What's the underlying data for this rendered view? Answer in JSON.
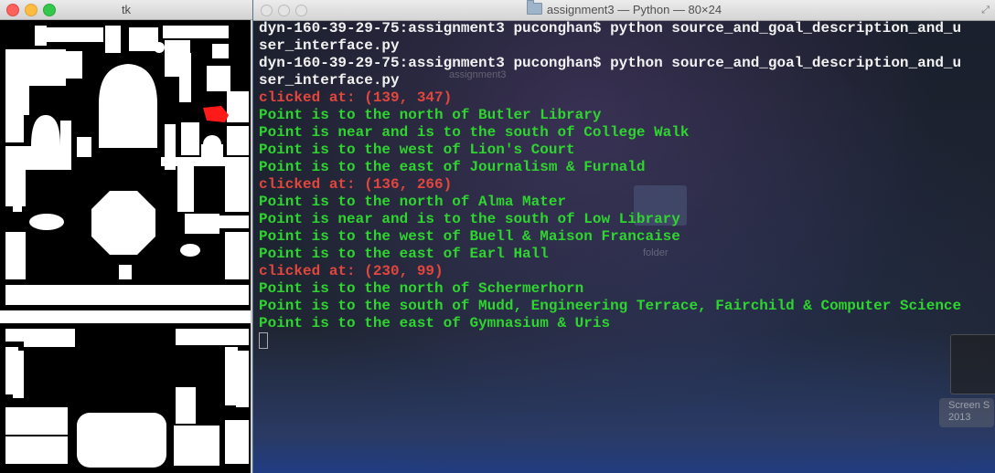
{
  "tk_window": {
    "title": "tk",
    "marker_color": "#ff1a1a"
  },
  "terminal": {
    "title": "assignment3 — Python — 80×24",
    "desktop_labels": [
      "assignment3",
      "folder"
    ],
    "desktop_screenshot_label": "Screen S\n2013",
    "colors": {
      "prompt": "#f2f2f2",
      "clicked": "#e2463c",
      "point": "#2fd52f"
    },
    "lines": [
      {
        "kind": "prompt",
        "text": "dyn-160-39-29-75:assignment3 puconghan$ python source_and_goal_description_and_u"
      },
      {
        "kind": "prompt",
        "text": "ser_interface.py"
      },
      {
        "kind": "prompt",
        "text": "dyn-160-39-29-75:assignment3 puconghan$ python source_and_goal_description_and_u"
      },
      {
        "kind": "prompt",
        "text": "ser_interface.py"
      },
      {
        "kind": "click",
        "text": "clicked at: (139, 347)"
      },
      {
        "kind": "point",
        "text": "Point is to the north of Butler Library"
      },
      {
        "kind": "point",
        "text": "Point is near and is to the south of College Walk"
      },
      {
        "kind": "point",
        "text": "Point is to the west of Lion's Court"
      },
      {
        "kind": "point",
        "text": "Point is to the east of Journalism & Furnald"
      },
      {
        "kind": "click",
        "text": "clicked at: (136, 266)"
      },
      {
        "kind": "point",
        "text": "Point is to the north of Alma Mater"
      },
      {
        "kind": "point",
        "text": "Point is near and is to the south of Low Library"
      },
      {
        "kind": "point",
        "text": "Point is to the west of Buell & Maison Francaise"
      },
      {
        "kind": "point",
        "text": "Point is to the east of Earl Hall"
      },
      {
        "kind": "click",
        "text": "clicked at: (230, 99)"
      },
      {
        "kind": "point",
        "text": "Point is to the north of Schermerhorn"
      },
      {
        "kind": "point",
        "text": "Point is to the south of Mudd, Engineering Terrace, Fairchild & Computer Science"
      },
      {
        "kind": "point",
        "text": "Point is to the east of Gymnasium & Uris"
      }
    ]
  }
}
